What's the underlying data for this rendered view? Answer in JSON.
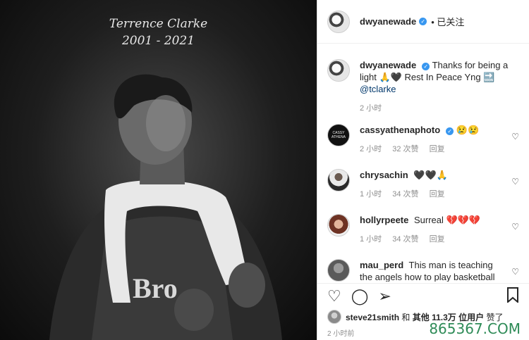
{
  "photo": {
    "name": "Terrence Clarke",
    "years": "2001 - 2021",
    "jersey_text": "Bro"
  },
  "header": {
    "username": "dwyanewade",
    "verified_mark": "✓",
    "follow_status": "• 已关注"
  },
  "caption": {
    "username": "dwyanewade",
    "text": "Thanks for being a light 🙏🖤 Rest In Peace Yng 🔜",
    "mention": "@tclarke",
    "time": "2 小时"
  },
  "comments": [
    {
      "username": "cassyathenaphoto",
      "avatar_text": "CASSY ATHENA",
      "text": "😢😢",
      "time": "2 小时",
      "likes": "32 次赞",
      "reply": "回复"
    },
    {
      "username": "chrysachin",
      "text": "🖤🖤🙏",
      "time": "1 小时",
      "likes": "34 次赞",
      "reply": "回复"
    },
    {
      "username": "hollyrpeete",
      "text": "Surreal 💔💔💔",
      "time": "1 小时",
      "likes": "34 次赞",
      "reply": "回复"
    },
    {
      "username": "mau_perd",
      "text": "This man is teaching the angels how to play basketball"
    }
  ],
  "actions": {
    "like_icon": "heart-outline-icon",
    "comment_icon": "comment-icon",
    "share_icon": "share-icon",
    "save_icon": "bookmark-icon"
  },
  "likes": {
    "user": "steve21smith",
    "text_mid": "和",
    "others": "其他 11.3万 位用户",
    "text_end": "赞了"
  },
  "post_time": "2 小时前",
  "watermark": "865367.COM"
}
